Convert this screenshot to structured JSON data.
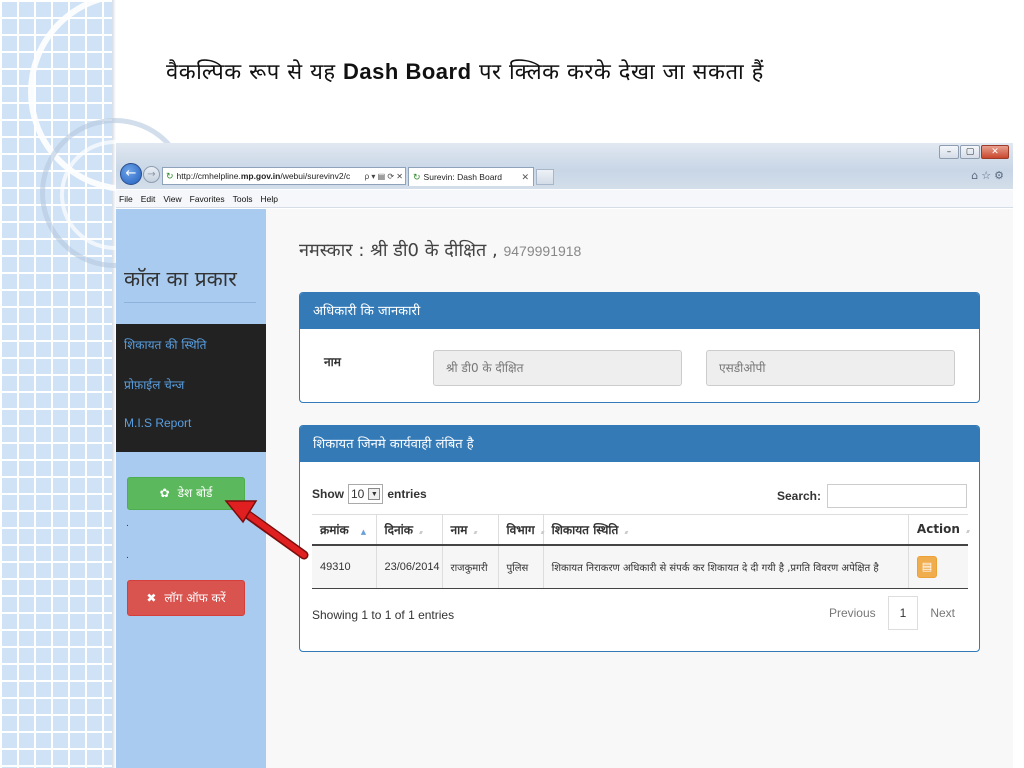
{
  "slide": {
    "title_pre": "वैकल्पिक रूप  से यह ",
    "title_bold": "Dash Board",
    "title_post": " पर क्लिक करके देखा जा सकता हैं"
  },
  "browser": {
    "url_prefix": "http://cmhelpline.",
    "url_domain": "mp.gov.in",
    "url_suffix": "/webui/surevinv2/c",
    "addr_tools": "ρ ▾ ▤ ⟳ ✕",
    "tab_title": "Surevin: Dash Board",
    "tab_close": "✕",
    "menu": [
      "File",
      "Edit",
      "View",
      "Favorites",
      "Tools",
      "Help"
    ],
    "tool_icons": "⌂☆⚙",
    "window_buttons": [
      "–",
      "▢",
      "✕"
    ]
  },
  "sidebar": {
    "heading": "कॉल का प्रकार",
    "links": [
      "शिकायत की स्थिति",
      "प्रोफ़ाईल चेन्ज",
      "M.I.S Report"
    ],
    "dash_button": "डेश बोर्ड",
    "dash_icon": "✿",
    "logout_button": "लॉग ऑफ करें",
    "logout_icon": "✖",
    "dot1": ".",
    "dot2": "."
  },
  "greeting": {
    "text": "नमस्कार : श्री डी0 के दीक्षित ,",
    "phone": "9479991918"
  },
  "officer_panel": {
    "title": "अधिकारी कि जानकारी",
    "label": "नाम",
    "name_value": "श्री डी0 के दीक्षित",
    "post_value": "एसडीओपी"
  },
  "complaint_panel": {
    "title": "शिकायत जिनमे कार्यवाही लंबित है",
    "show_label": "Show",
    "page_length": "10",
    "entries_label": "entries",
    "search_label": "Search:",
    "columns": [
      "क्रमांक",
      "दिनांक",
      "नाम",
      "विभाग",
      "शिकायत स्थिति",
      "Action"
    ],
    "rows": [
      {
        "id": "49310",
        "date": "23/06/2014",
        "name": "राजकुमारी",
        "department": "पुलिस",
        "status": "शिकायत निराकरण अधिकारी से संपर्क कर शिकायत दे दी गयी है ,प्रगति विवरण अपेक्षित है",
        "action_icon": "▤"
      }
    ],
    "info": "Showing 1 to 1 of 1 entries",
    "prev": "Previous",
    "page": "1",
    "next": "Next"
  },
  "colors": {
    "panel_blue": "#337ab7",
    "sidebar_blue": "#a9cbef",
    "success_green": "#5cb85c",
    "danger_red": "#d9534f",
    "warning_orange": "#f0ad4e",
    "annotation_arrow": "#e02020"
  }
}
